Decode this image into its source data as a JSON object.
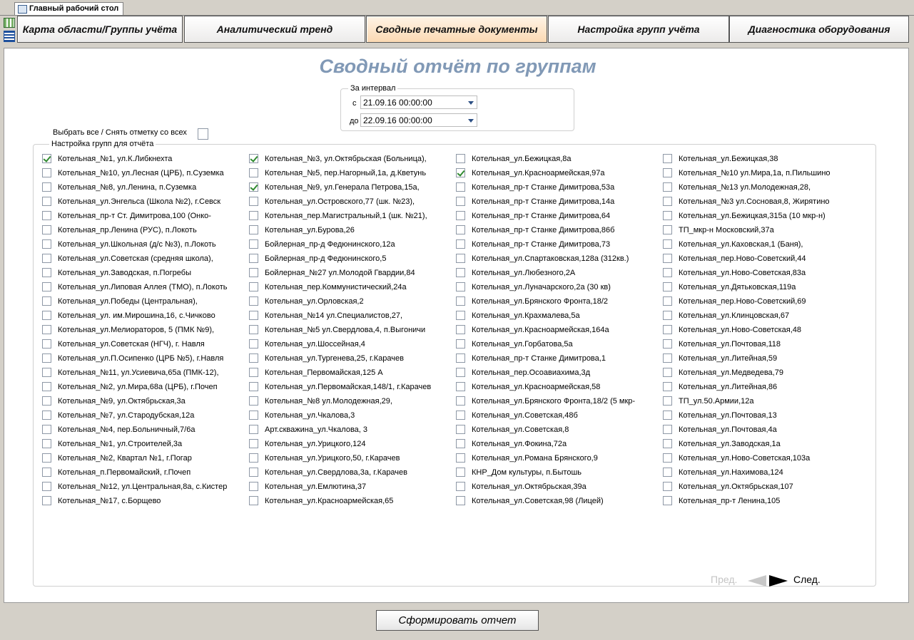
{
  "doc_tab": {
    "label": "Главный рабочий стол"
  },
  "menu": [
    {
      "label": "Карта области/Группы учёта",
      "active": false
    },
    {
      "label": "Аналитический тренд",
      "active": false
    },
    {
      "label": "Сводные печатные документы",
      "active": true
    },
    {
      "label": "Настройка групп учёта",
      "active": false
    },
    {
      "label": "Диагностика оборудования",
      "active": false
    }
  ],
  "report": {
    "title": "Сводный отчёт по группам",
    "interval_legend": "За интервал",
    "from_label": "с",
    "from_value": "21.09.16 00:00:00",
    "to_label": "до",
    "to_value": "22.09.16 00:00:00",
    "select_all_label": "Выбрать все / Снять отметку со всех",
    "select_all_checked": false,
    "groups_legend": "Настройка групп для отчёта",
    "prev_label": "Пред.",
    "next_label": "След.",
    "generate_label": "Сформировать отчет"
  },
  "columns": [
    [
      {
        "label": "Котельная_№1, ул.К.Либкнехта",
        "checked": true
      },
      {
        "label": "Котельная_№10, ул.Лесная (ЦРБ), п.Суземка",
        "checked": false
      },
      {
        "label": "Котельная_№8, ул.Ленина, п.Суземка",
        "checked": false
      },
      {
        "label": "Котельная_ул.Энгельса (Школа №2), г.Севск",
        "checked": false
      },
      {
        "label": "Котельная_пр-т Ст. Димитрова,100 (Онко-",
        "checked": false
      },
      {
        "label": "Котельная_пр.Ленина (РУС), п.Локоть",
        "checked": false
      },
      {
        "label": "Котельная_ул.Школьная (д/с №3), п.Локоть",
        "checked": false
      },
      {
        "label": "Котельная_ул.Советская (средняя школа),",
        "checked": false
      },
      {
        "label": "Котельная_ул.Заводская, п.Погребы",
        "checked": false
      },
      {
        "label": "Котельная_ул.Липовая Аллея (ТМО), п.Локоть",
        "checked": false
      },
      {
        "label": "Котельная_ул.Победы (Центральная),",
        "checked": false
      },
      {
        "label": "Котельная_ул. им.Мирошина,16, с.Чичково",
        "checked": false
      },
      {
        "label": "Котельная_ул.Мелиораторов, 5 (ПМК №9),",
        "checked": false
      },
      {
        "label": "Котельная_ул.Советская (НГЧ), г. Навля",
        "checked": false
      },
      {
        "label": "Котельная_ул.П.Осипенко (ЦРБ №5), г.Навля",
        "checked": false
      },
      {
        "label": "Котельная_№11, ул.Усиевича,65а (ПМК-12),",
        "checked": false
      },
      {
        "label": "Котельная_№2, ул.Мира,68а (ЦРБ), г.Почеп",
        "checked": false
      },
      {
        "label": "Котельная_№9, ул.Октябрьская,3а",
        "checked": false
      },
      {
        "label": "Котельная_№7, ул.Стародубская,12а",
        "checked": false
      },
      {
        "label": "Котельная_№4, пер.Больничный,7/6а",
        "checked": false
      },
      {
        "label": "Котельная_№1, ул.Строителей,3а",
        "checked": false
      },
      {
        "label": "Котельная_№2, Квартал №1, г.Погар",
        "checked": false
      },
      {
        "label": "Котельная_п.Первомайский, г.Почеп",
        "checked": false
      },
      {
        "label": "Котельная_№12, ул.Центральная,8а, с.Кистер",
        "checked": false
      },
      {
        "label": "Котельная_№17, с.Борщево",
        "checked": false
      }
    ],
    [
      {
        "label": "Котельная_№3, ул.Октябрьская (Больница),",
        "checked": true
      },
      {
        "label": "Котельная_№5, пер.Нагорный,1а, д.Кветунь",
        "checked": false
      },
      {
        "label": "Котельная_№9, ул.Генерала Петрова,15а,",
        "checked": true
      },
      {
        "label": "Котельная_ул.Островского,77 (шк. №23),",
        "checked": false
      },
      {
        "label": "Котельная_пер.Магистральный,1 (шк. №21),",
        "checked": false
      },
      {
        "label": "Котельная_ул.Бурова,26",
        "checked": false
      },
      {
        "label": "Бойлерная_пр-д Федюнинского,12а",
        "checked": false
      },
      {
        "label": "Бойлерная_пр-д Федюнинского,5",
        "checked": false
      },
      {
        "label": "Бойлерная_№27 ул.Молодой Гвардии,84",
        "checked": false
      },
      {
        "label": "Котельная_пер.Коммунистический,24а",
        "checked": false
      },
      {
        "label": "Котельная_ул.Орловская,2",
        "checked": false
      },
      {
        "label": "Котельная_№14 ул.Специалистов,27,",
        "checked": false
      },
      {
        "label": "Котельная_№5 ул.Свердлова,4, п.Выгоничи",
        "checked": false
      },
      {
        "label": "Котельная_ул.Шоссейная,4",
        "checked": false
      },
      {
        "label": "Котельная_ул.Тургенева,25, г.Карачев",
        "checked": false
      },
      {
        "label": "Котельная_Первомайская,125 А",
        "checked": false
      },
      {
        "label": "Котельная_ул.Первомайская,148/1, г.Карачев",
        "checked": false
      },
      {
        "label": "Котельная_№8 ул.Молодежная,29,",
        "checked": false
      },
      {
        "label": "Котельная_ул.Чкалова,3",
        "checked": false
      },
      {
        "label": "Арт.скважина_ул.Чкалова, 3",
        "checked": false
      },
      {
        "label": "Котельная_ул.Урицкого,124",
        "checked": false
      },
      {
        "label": "Котельная_ул.Урицкого,50, г.Карачев",
        "checked": false
      },
      {
        "label": "Котельная_ул.Свердлова,3а, г.Карачев",
        "checked": false
      },
      {
        "label": "Котельная_ул.Емлютина,37",
        "checked": false
      },
      {
        "label": "Котельная_ул.Красноармейская,65",
        "checked": false
      }
    ],
    [
      {
        "label": "Котельная_ул.Бежицкая,8а",
        "checked": false
      },
      {
        "label": "Котельная_ул.Красноармейская,97а",
        "checked": true
      },
      {
        "label": "Котельная_пр-т Станке Димитрова,53а",
        "checked": false
      },
      {
        "label": "Котельная_пр-т Станке Димитрова,14а",
        "checked": false
      },
      {
        "label": "Котельная_пр-т Станке Димитрова,64",
        "checked": false
      },
      {
        "label": "Котельная_пр-т Станке Димитрова,86б",
        "checked": false
      },
      {
        "label": "Котельная_пр-т Станке Димитрова,73",
        "checked": false
      },
      {
        "label": "Котельная_ул.Спартаковская,128а (312кв.)",
        "checked": false
      },
      {
        "label": "Котельная_ул.Любезного,2А",
        "checked": false
      },
      {
        "label": "Котельная_ул.Луначарского,2а (30 кв)",
        "checked": false
      },
      {
        "label": "Котельная_ул.Брянского Фронта,18/2",
        "checked": false
      },
      {
        "label": "Котельная_ул.Крахмалева,5а",
        "checked": false
      },
      {
        "label": "Котельная_ул.Красноармейская,164а",
        "checked": false
      },
      {
        "label": "Котельная_ул.Горбатова,5а",
        "checked": false
      },
      {
        "label": "Котельная_пр-т Станке Димитрова,1",
        "checked": false
      },
      {
        "label": "Котельная_пер.Осоавиахима,3д",
        "checked": false
      },
      {
        "label": "Котельная_ул.Красноармейская,58",
        "checked": false
      },
      {
        "label": "Котельная_ул.Брянского Фронта,18/2 (5 мкр-",
        "checked": false
      },
      {
        "label": "Котельная_ул.Советская,48б",
        "checked": false
      },
      {
        "label": "Котельная_ул.Советская,8",
        "checked": false
      },
      {
        "label": "Котельная_ул.Фокина,72а",
        "checked": false
      },
      {
        "label": "Котельная_ул.Романа Брянского,9",
        "checked": false
      },
      {
        "label": "КНР_Дом культуры, п.Бытошь",
        "checked": false
      },
      {
        "label": "Котельная_ул.Октябрьская,39а",
        "checked": false
      },
      {
        "label": "Котельная_ул.Советская,98 (Лицей)",
        "checked": false
      }
    ],
    [
      {
        "label": "Котельная_ул.Бежицкая,38",
        "checked": false
      },
      {
        "label": "Котельная_№10 ул.Мира,1а, п.Пильшино",
        "checked": false
      },
      {
        "label": "Котельная_№13 ул.Молодежная,28,",
        "checked": false
      },
      {
        "label": "Котельная_№3 ул.Сосновая,8, Жирятино",
        "checked": false
      },
      {
        "label": "Котельная_ул.Бежицкая,315а (10 мкр-н)",
        "checked": false
      },
      {
        "label": "ТП_мкр-н Московский,37а",
        "checked": false
      },
      {
        "label": "Котельная_ул.Каховская,1 (Баня),",
        "checked": false
      },
      {
        "label": "Котельная_пер.Ново-Советский,44",
        "checked": false
      },
      {
        "label": "Котельная_ул.Ново-Советская,83а",
        "checked": false
      },
      {
        "label": "Котельная_ул.Дятьковская,119а",
        "checked": false
      },
      {
        "label": "Котельная_пер.Ново-Советский,69",
        "checked": false
      },
      {
        "label": "Котельная_ул.Клинцовская,67",
        "checked": false
      },
      {
        "label": "Котельная_ул.Ново-Советская,48",
        "checked": false
      },
      {
        "label": "Котельная_ул.Почтовая,118",
        "checked": false
      },
      {
        "label": "Котельная_ул.Литейная,59",
        "checked": false
      },
      {
        "label": "Котельная_ул.Медведева,79",
        "checked": false
      },
      {
        "label": "Котельная_ул.Литейная,86",
        "checked": false
      },
      {
        "label": "ТП_ул.50.Армии,12а",
        "checked": false
      },
      {
        "label": "Котельная_ул.Почтовая,13",
        "checked": false
      },
      {
        "label": "Котельная_ул.Почтовая,4а",
        "checked": false
      },
      {
        "label": "Котельная_ул.Заводская,1а",
        "checked": false
      },
      {
        "label": "Котельная_ул.Ново-Советская,103а",
        "checked": false
      },
      {
        "label": "Котельная_ул.Нахимова,124",
        "checked": false
      },
      {
        "label": "Котельная_ул.Октябрьская,107",
        "checked": false
      },
      {
        "label": "Котельная_пр-т Ленина,105",
        "checked": false
      }
    ]
  ]
}
